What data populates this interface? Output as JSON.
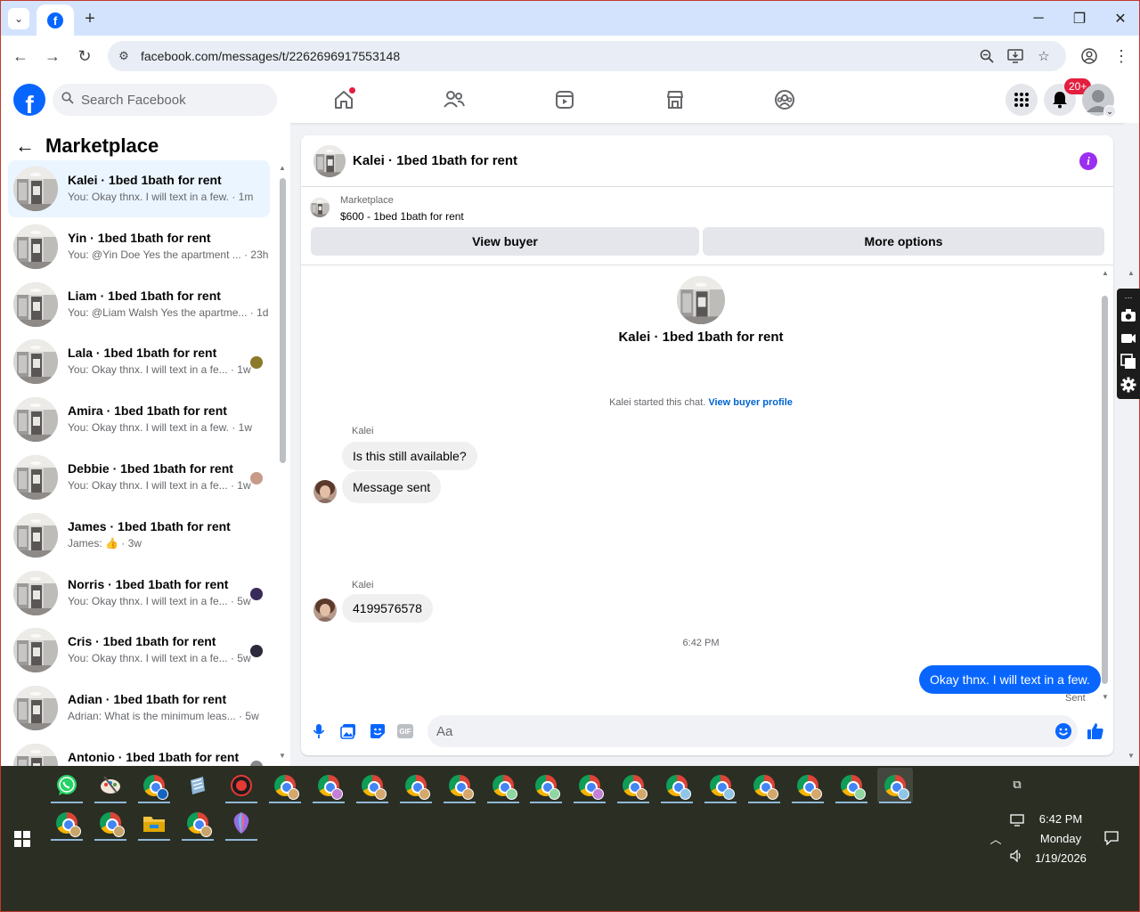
{
  "browser": {
    "url": "facebook.com/messages/t/2262696917553148",
    "new_tab_label": "+"
  },
  "fb": {
    "logo": "f",
    "search_placeholder": "Search Facebook",
    "notif_badge": "20+"
  },
  "sidebar": {
    "title": "Marketplace",
    "conversations": [
      {
        "name": "Kalei · 1bed 1bath for rent",
        "snippet": "You: Okay thnx. I will text in a few. · 1m",
        "active": true,
        "mini": ""
      },
      {
        "name": "Yin · 1bed 1bath for rent",
        "snippet": "You: @Yin Doe Yes the apartment ... · 23h",
        "active": false,
        "mini": ""
      },
      {
        "name": "Liam · 1bed 1bath for rent",
        "snippet": "You: @Liam Walsh Yes the apartme... · 1d",
        "active": false,
        "mini": ""
      },
      {
        "name": "Lala · 1bed 1bath for rent",
        "snippet": "You: Okay thnx. I will text in a fe... · 1w",
        "active": false,
        "mini": "#8a7a2a"
      },
      {
        "name": "Amira · 1bed 1bath for rent",
        "snippet": "You: Okay thnx. I will text in a few. · 1w",
        "active": false,
        "mini": ""
      },
      {
        "name": "Debbie · 1bed 1bath for rent",
        "snippet": "You: Okay thnx. I will text in a fe... · 1w",
        "active": false,
        "mini": "#c89a8a"
      },
      {
        "name": "James · 1bed 1bath for rent",
        "snippet": "James: 👍 · 3w",
        "active": false,
        "mini": ""
      },
      {
        "name": "Norris · 1bed 1bath for rent",
        "snippet": "You: Okay thnx. I will text in a fe... · 5w",
        "active": false,
        "mini": "#3a2a5a"
      },
      {
        "name": "Cris · 1bed 1bath for rent",
        "snippet": "You: Okay thnx. I will text in a fe... · 5w",
        "active": false,
        "mini": "#2a2a3a"
      },
      {
        "name": "Adian · 1bed 1bath for rent",
        "snippet": "Adrian: What is the minimum leas... · 5w",
        "active": false,
        "mini": ""
      },
      {
        "name": "Antonio · 1bed 1bath for rent",
        "snippet": "",
        "active": false,
        "mini": "#888888"
      }
    ]
  },
  "chat": {
    "title": "Kalei · 1bed 1bath for rent",
    "listing_source": "Marketplace",
    "listing_price": "$600 - 1bed 1bath for rent",
    "view_buyer": "View buyer",
    "more_options": "More options",
    "thread_title": "Kalei · 1bed 1bath for rent",
    "started_text": "Kalei started this chat.",
    "view_buyer_profile": "View buyer profile",
    "messages": [
      {
        "sender": "Kalei",
        "text": "Is this still available?"
      },
      {
        "sender": "",
        "text": "Message sent"
      },
      {
        "sender": "Kalei",
        "text": "4199576578"
      },
      {
        "sender": "You",
        "text": "Okay thnx. I will text in a few."
      }
    ],
    "timestamp": "6:42 PM",
    "sent_label": "Sent",
    "input_placeholder": "Aa",
    "gif_label": "GIF"
  },
  "taskbar": {
    "time": "6:42 PM",
    "day": "Monday",
    "date": "1/19/2026"
  },
  "colors": {
    "fb_blue": "#0866ff",
    "badge_red": "#e41e3f",
    "info_purple": "#9b2ef0",
    "taskbar_bg": "#2b2e23"
  }
}
